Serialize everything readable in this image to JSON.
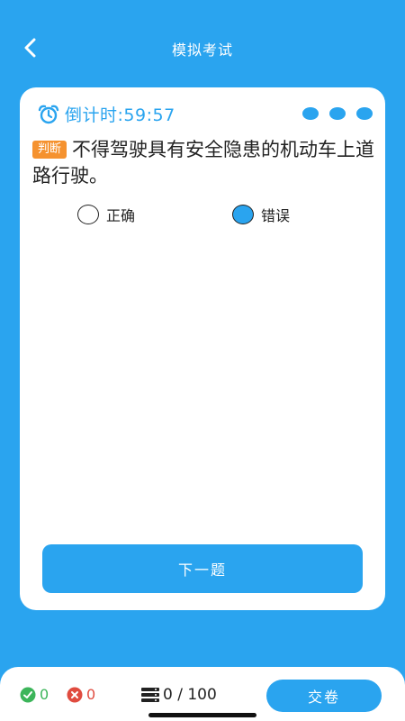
{
  "header": {
    "title": "模拟考试",
    "back_icon": "chevron-left-icon"
  },
  "timer": {
    "icon": "alarm-clock-icon",
    "text": "倒计时:59:57"
  },
  "more_menu_icon": "more-dots-icon",
  "question": {
    "type_badge": "判断",
    "text": "不得驾驶具有安全隐患的机动车上道路行驶。"
  },
  "options": [
    {
      "label": "正确",
      "selected": false
    },
    {
      "label": "错误",
      "selected": true
    }
  ],
  "next_button": {
    "label": "下一题"
  },
  "bottom_bar": {
    "correct_count": "0",
    "wrong_count": "0",
    "progress": "0 / 100",
    "submit_label": "交卷"
  },
  "colors": {
    "primary": "#2aa4ef",
    "badge": "#f5922f",
    "correct": "#3cb55a",
    "wrong": "#e04b3f"
  }
}
